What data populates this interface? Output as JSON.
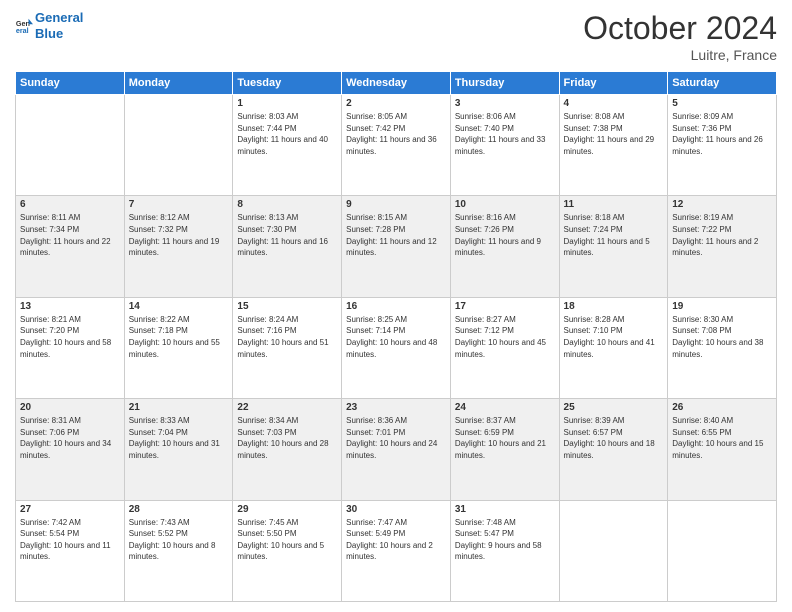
{
  "header": {
    "logo_line1": "General",
    "logo_line2": "Blue",
    "month": "October 2024",
    "location": "Luitre, France"
  },
  "days_of_week": [
    "Sunday",
    "Monday",
    "Tuesday",
    "Wednesday",
    "Thursday",
    "Friday",
    "Saturday"
  ],
  "weeks": [
    [
      {
        "num": "",
        "info": ""
      },
      {
        "num": "",
        "info": ""
      },
      {
        "num": "1",
        "info": "Sunrise: 8:03 AM\nSunset: 7:44 PM\nDaylight: 11 hours and 40 minutes."
      },
      {
        "num": "2",
        "info": "Sunrise: 8:05 AM\nSunset: 7:42 PM\nDaylight: 11 hours and 36 minutes."
      },
      {
        "num": "3",
        "info": "Sunrise: 8:06 AM\nSunset: 7:40 PM\nDaylight: 11 hours and 33 minutes."
      },
      {
        "num": "4",
        "info": "Sunrise: 8:08 AM\nSunset: 7:38 PM\nDaylight: 11 hours and 29 minutes."
      },
      {
        "num": "5",
        "info": "Sunrise: 8:09 AM\nSunset: 7:36 PM\nDaylight: 11 hours and 26 minutes."
      }
    ],
    [
      {
        "num": "6",
        "info": "Sunrise: 8:11 AM\nSunset: 7:34 PM\nDaylight: 11 hours and 22 minutes."
      },
      {
        "num": "7",
        "info": "Sunrise: 8:12 AM\nSunset: 7:32 PM\nDaylight: 11 hours and 19 minutes."
      },
      {
        "num": "8",
        "info": "Sunrise: 8:13 AM\nSunset: 7:30 PM\nDaylight: 11 hours and 16 minutes."
      },
      {
        "num": "9",
        "info": "Sunrise: 8:15 AM\nSunset: 7:28 PM\nDaylight: 11 hours and 12 minutes."
      },
      {
        "num": "10",
        "info": "Sunrise: 8:16 AM\nSunset: 7:26 PM\nDaylight: 11 hours and 9 minutes."
      },
      {
        "num": "11",
        "info": "Sunrise: 8:18 AM\nSunset: 7:24 PM\nDaylight: 11 hours and 5 minutes."
      },
      {
        "num": "12",
        "info": "Sunrise: 8:19 AM\nSunset: 7:22 PM\nDaylight: 11 hours and 2 minutes."
      }
    ],
    [
      {
        "num": "13",
        "info": "Sunrise: 8:21 AM\nSunset: 7:20 PM\nDaylight: 10 hours and 58 minutes."
      },
      {
        "num": "14",
        "info": "Sunrise: 8:22 AM\nSunset: 7:18 PM\nDaylight: 10 hours and 55 minutes."
      },
      {
        "num": "15",
        "info": "Sunrise: 8:24 AM\nSunset: 7:16 PM\nDaylight: 10 hours and 51 minutes."
      },
      {
        "num": "16",
        "info": "Sunrise: 8:25 AM\nSunset: 7:14 PM\nDaylight: 10 hours and 48 minutes."
      },
      {
        "num": "17",
        "info": "Sunrise: 8:27 AM\nSunset: 7:12 PM\nDaylight: 10 hours and 45 minutes."
      },
      {
        "num": "18",
        "info": "Sunrise: 8:28 AM\nSunset: 7:10 PM\nDaylight: 10 hours and 41 minutes."
      },
      {
        "num": "19",
        "info": "Sunrise: 8:30 AM\nSunset: 7:08 PM\nDaylight: 10 hours and 38 minutes."
      }
    ],
    [
      {
        "num": "20",
        "info": "Sunrise: 8:31 AM\nSunset: 7:06 PM\nDaylight: 10 hours and 34 minutes."
      },
      {
        "num": "21",
        "info": "Sunrise: 8:33 AM\nSunset: 7:04 PM\nDaylight: 10 hours and 31 minutes."
      },
      {
        "num": "22",
        "info": "Sunrise: 8:34 AM\nSunset: 7:03 PM\nDaylight: 10 hours and 28 minutes."
      },
      {
        "num": "23",
        "info": "Sunrise: 8:36 AM\nSunset: 7:01 PM\nDaylight: 10 hours and 24 minutes."
      },
      {
        "num": "24",
        "info": "Sunrise: 8:37 AM\nSunset: 6:59 PM\nDaylight: 10 hours and 21 minutes."
      },
      {
        "num": "25",
        "info": "Sunrise: 8:39 AM\nSunset: 6:57 PM\nDaylight: 10 hours and 18 minutes."
      },
      {
        "num": "26",
        "info": "Sunrise: 8:40 AM\nSunset: 6:55 PM\nDaylight: 10 hours and 15 minutes."
      }
    ],
    [
      {
        "num": "27",
        "info": "Sunrise: 7:42 AM\nSunset: 5:54 PM\nDaylight: 10 hours and 11 minutes."
      },
      {
        "num": "28",
        "info": "Sunrise: 7:43 AM\nSunset: 5:52 PM\nDaylight: 10 hours and 8 minutes."
      },
      {
        "num": "29",
        "info": "Sunrise: 7:45 AM\nSunset: 5:50 PM\nDaylight: 10 hours and 5 minutes."
      },
      {
        "num": "30",
        "info": "Sunrise: 7:47 AM\nSunset: 5:49 PM\nDaylight: 10 hours and 2 minutes."
      },
      {
        "num": "31",
        "info": "Sunrise: 7:48 AM\nSunset: 5:47 PM\nDaylight: 9 hours and 58 minutes."
      },
      {
        "num": "",
        "info": ""
      },
      {
        "num": "",
        "info": ""
      }
    ]
  ]
}
